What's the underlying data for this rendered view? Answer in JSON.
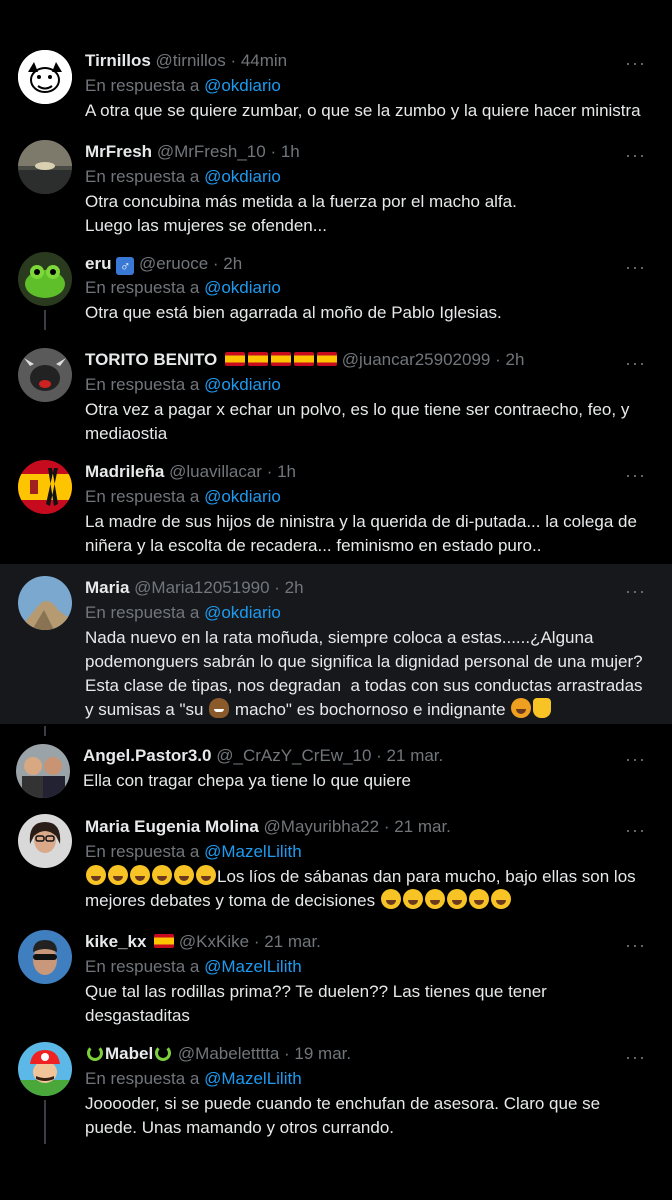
{
  "colors": {
    "background": "#000000",
    "text": "#e7e9ea",
    "muted": "#71767b",
    "link": "#1d9bf0",
    "highlight": "#16181c"
  },
  "more_icon": "more-horizontal-icon",
  "tweets": [
    {
      "name": "Tirnillos",
      "handle": "@tirnillos",
      "time": "· 44min",
      "reply_prefix": "En respuesta a",
      "mention": "@okdiario",
      "text": "A otra que se quiere zumbar, o que se la zumbo y la quiere hacer ministra",
      "avatar": "dog-cartoon-avatar"
    },
    {
      "name": "MrFresh",
      "handle": "@MrFresh_10",
      "time": "· 1h",
      "reply_prefix": "En respuesta a",
      "mention": "@okdiario",
      "text": "Otra concubina más metida a la fuerza por el macho alfa.\nLuego las mujeres se ofenden...",
      "avatar": "sunset-sea-avatar"
    },
    {
      "name": "eru",
      "handle": "@eruoce",
      "time": "· 2h",
      "reply_prefix": "En respuesta a",
      "mention": "@okdiario",
      "text": "Otra que está bien agarrada al moño de Pablo Iglesias.",
      "avatar": "green-frog-avatar",
      "badge": "male-sign-emoji"
    },
    {
      "name": "TORITO BENITO",
      "handle": "@juancar25902099",
      "time": "· 2h",
      "reply_prefix": "En respuesta a",
      "mention": "@okdiario",
      "text": "Otra vez a pagar x echar un polvo, es lo que tiene ser contraecho, feo, y\nmediaostia",
      "avatar": "bull-plush-avatar",
      "badge": "spain-flag-emoji-x5"
    },
    {
      "name": "Madrileña",
      "handle": "@luavillacar",
      "time": "· 1h",
      "reply_prefix": "En respuesta a",
      "mention": "@okdiario",
      "text": "La madre de sus hijos de ninistra y la querida de di-putada... la colega de\nniñera y la escolta de recadera... feminismo en estado puro..",
      "avatar": "spain-flag-ribbon-avatar"
    },
    {
      "name": "Maria",
      "handle": "@Maria12051990",
      "time": "· 2h",
      "reply_prefix": "En respuesta a",
      "mention": "@okdiario",
      "text_parts": [
        "Nada nuevo en la rata moñuda, siempre coloca a estas......¿Alguna\npodemonguers sabrán lo que significa la dignidad personal de una mujer?\nEsta clase de tipas, nos degradan  a todas con sus conductas arrastradas\ny sumisas a \"su ",
        " macho\" es bochornoso e indignante "
      ],
      "avatar": "sky-rock-avatar"
    },
    {
      "name": "Angel.Pastor3.0",
      "handle": "@_CrAzY_CrEw_10",
      "time": "· 21 mar.",
      "text": "Ella con tragar chepa ya tiene lo que quiere",
      "avatar": "two-people-avatar"
    },
    {
      "name": "Maria Eugenia Molina",
      "handle": "@Mayuribha22",
      "time": "· 21 mar.",
      "reply_prefix": "En respuesta a",
      "mention": "@MazelLilith",
      "text_parts": [
        "Los líos de sábanas dan para mucho, bajo ellas son los\nmejores debates y toma de decisiones "
      ],
      "avatar": "woman-glasses-avatar"
    },
    {
      "name": "kike_kx",
      "handle": "@KxKike",
      "time": "· 21 mar.",
      "reply_prefix": "En respuesta a",
      "mention": "@MazelLilith",
      "text": "Que tal las rodillas prima?? Te duelen?? Las tienes que tener\ndesgastaditas",
      "avatar": "man-sunglasses-avatar",
      "badge": "spain-flag-emoji"
    },
    {
      "name": "Mabel",
      "handle": "@Mabeletttta",
      "time": "· 19 mar.",
      "reply_prefix": "En respuesta a",
      "mention": "@MazelLilith",
      "text": "Jooooder, si se puede cuando te enchufan de asesora. Claro que se\npuede. Unas mamando y otros currando.",
      "avatar": "mario-avatar",
      "badge": "snake-emoji"
    }
  ]
}
